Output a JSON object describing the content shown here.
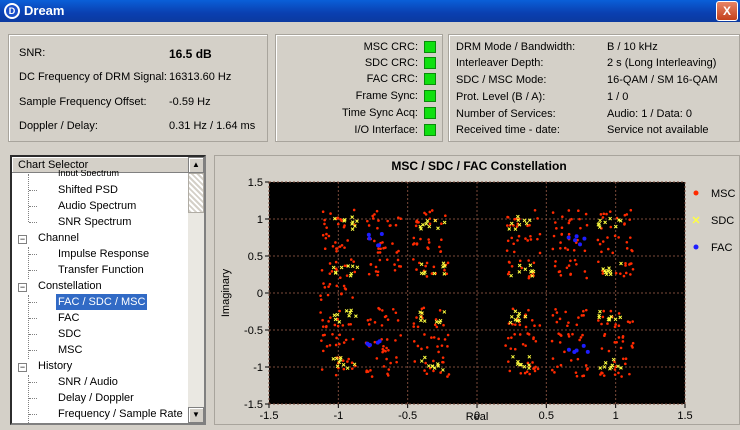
{
  "window": {
    "title": "Dream",
    "app_icon_letter": "D",
    "close_label": "X"
  },
  "status_left": [
    {
      "label": "SNR:",
      "value": "16.5 dB"
    },
    {
      "label": "DC Frequency of DRM Signal:",
      "value": "16313.60 Hz"
    },
    {
      "label": "Sample Frequency Offset:",
      "value": "-0.59 Hz"
    },
    {
      "label": "Doppler / Delay:",
      "value": "0.31 Hz / 1.64 ms"
    }
  ],
  "crc_indicators": [
    {
      "label": "MSC CRC:",
      "color": "#10e010"
    },
    {
      "label": "SDC CRC:",
      "color": "#10e010"
    },
    {
      "label": "FAC CRC:",
      "color": "#10e010"
    },
    {
      "label": "Frame Sync:",
      "color": "#10e010"
    },
    {
      "label": "Time Sync Acq:",
      "color": "#10e010"
    },
    {
      "label": "I/O Interface:",
      "color": "#10e010"
    }
  ],
  "mode_info": [
    {
      "label": "DRM Mode / Bandwidth:",
      "value": "B / 10 kHz"
    },
    {
      "label": "Interleaver Depth:",
      "value": "2 s (Long Interleaving)"
    },
    {
      "label": "SDC / MSC Mode:",
      "value": "16-QAM / SM 16-QAM"
    },
    {
      "label": "Prot. Level (B / A):",
      "value": "1 / 0"
    },
    {
      "label": "Number of Services:",
      "value": "Audio: 1 / Data: 0"
    },
    {
      "label": "Received time - date:",
      "value": "Service not available"
    }
  ],
  "chart_selector": {
    "header": "Chart Selector",
    "items": [
      {
        "label": "Input Spectrum",
        "level": 1
      },
      {
        "label": "Shifted PSD",
        "level": 1
      },
      {
        "label": "Audio Spectrum",
        "level": 1
      },
      {
        "label": "SNR Spectrum",
        "level": 1
      },
      {
        "label": "Channel",
        "level": 0
      },
      {
        "label": "Impulse Response",
        "level": 1
      },
      {
        "label": "Transfer Function",
        "level": 1
      },
      {
        "label": "Constellation",
        "level": 0
      },
      {
        "label": "FAC / SDC / MSC",
        "level": 1,
        "selected": true
      },
      {
        "label": "FAC",
        "level": 1
      },
      {
        "label": "SDC",
        "level": 1
      },
      {
        "label": "MSC",
        "level": 1
      },
      {
        "label": "History",
        "level": 0
      },
      {
        "label": "SNR / Audio",
        "level": 1
      },
      {
        "label": "Delay / Doppler",
        "level": 1
      },
      {
        "label": "Frequency / Sample Rate",
        "level": 1
      }
    ]
  },
  "chart_data": {
    "type": "scatter",
    "title": "MSC / SDC / FAC Constellation",
    "xlabel": "Real",
    "ylabel": "Imaginary",
    "xlim": [
      -1.5,
      1.5
    ],
    "ylim": [
      -1.5,
      1.5
    ],
    "xticks": [
      "-1.5",
      "-1",
      "-0.5",
      "0",
      "0.5",
      "1",
      "1.5"
    ],
    "yticks": [
      "1.5",
      "1",
      "0.5",
      "0",
      "-0.5",
      "-1",
      "-1.5"
    ],
    "grid": true,
    "background": "#000000",
    "legend_position": "right",
    "series": [
      {
        "name": "MSC",
        "color": "#ff2a00",
        "marker": "dot",
        "points": [
          [
            -1.0,
            1.0
          ],
          [
            -1.0,
            0.67
          ],
          [
            -1.0,
            0.33
          ],
          [
            -1.0,
            0.0
          ],
          [
            -1.0,
            -0.33
          ],
          [
            -1.0,
            -0.67
          ],
          [
            -1.0,
            -1.0
          ],
          [
            -0.67,
            1.0
          ],
          [
            -0.67,
            0.67
          ],
          [
            -0.67,
            0.33
          ],
          [
            -0.67,
            -0.33
          ],
          [
            -0.67,
            -0.67
          ],
          [
            -0.67,
            -1.0
          ],
          [
            -0.33,
            1.0
          ],
          [
            -0.33,
            0.67
          ],
          [
            -0.33,
            0.33
          ],
          [
            -0.33,
            -0.33
          ],
          [
            -0.33,
            -0.67
          ],
          [
            -0.33,
            -1.0
          ],
          [
            0.33,
            1.0
          ],
          [
            0.33,
            0.67
          ],
          [
            0.33,
            0.33
          ],
          [
            0.33,
            -0.33
          ],
          [
            0.33,
            -0.67
          ],
          [
            0.33,
            -1.0
          ],
          [
            0.67,
            1.0
          ],
          [
            0.67,
            0.67
          ],
          [
            0.67,
            0.33
          ],
          [
            0.67,
            -0.33
          ],
          [
            0.67,
            -0.67
          ],
          [
            0.67,
            -1.0
          ],
          [
            1.0,
            1.0
          ],
          [
            1.0,
            0.67
          ],
          [
            1.0,
            0.33
          ],
          [
            1.0,
            -0.33
          ],
          [
            1.0,
            -0.67
          ],
          [
            1.0,
            -1.0
          ]
        ]
      },
      {
        "name": "SDC",
        "color": "#ffff40",
        "marker": "cross",
        "points": [
          [
            -0.95,
            0.95
          ],
          [
            -0.95,
            0.32
          ],
          [
            -0.95,
            -0.32
          ],
          [
            -0.95,
            -0.95
          ],
          [
            -0.32,
            0.95
          ],
          [
            -0.32,
            0.32
          ],
          [
            -0.32,
            -0.32
          ],
          [
            -0.32,
            -0.95
          ],
          [
            0.32,
            0.95
          ],
          [
            0.32,
            0.32
          ],
          [
            0.32,
            -0.32
          ],
          [
            0.32,
            -0.95
          ],
          [
            0.95,
            0.95
          ],
          [
            0.95,
            0.32
          ],
          [
            0.95,
            -0.32
          ],
          [
            0.95,
            -0.95
          ]
        ]
      },
      {
        "name": "FAC",
        "color": "#1e1eff",
        "marker": "dot",
        "points": [
          [
            -0.72,
            0.72
          ],
          [
            -0.72,
            -0.72
          ],
          [
            0.72,
            0.72
          ],
          [
            0.72,
            -0.72
          ]
        ]
      }
    ]
  }
}
